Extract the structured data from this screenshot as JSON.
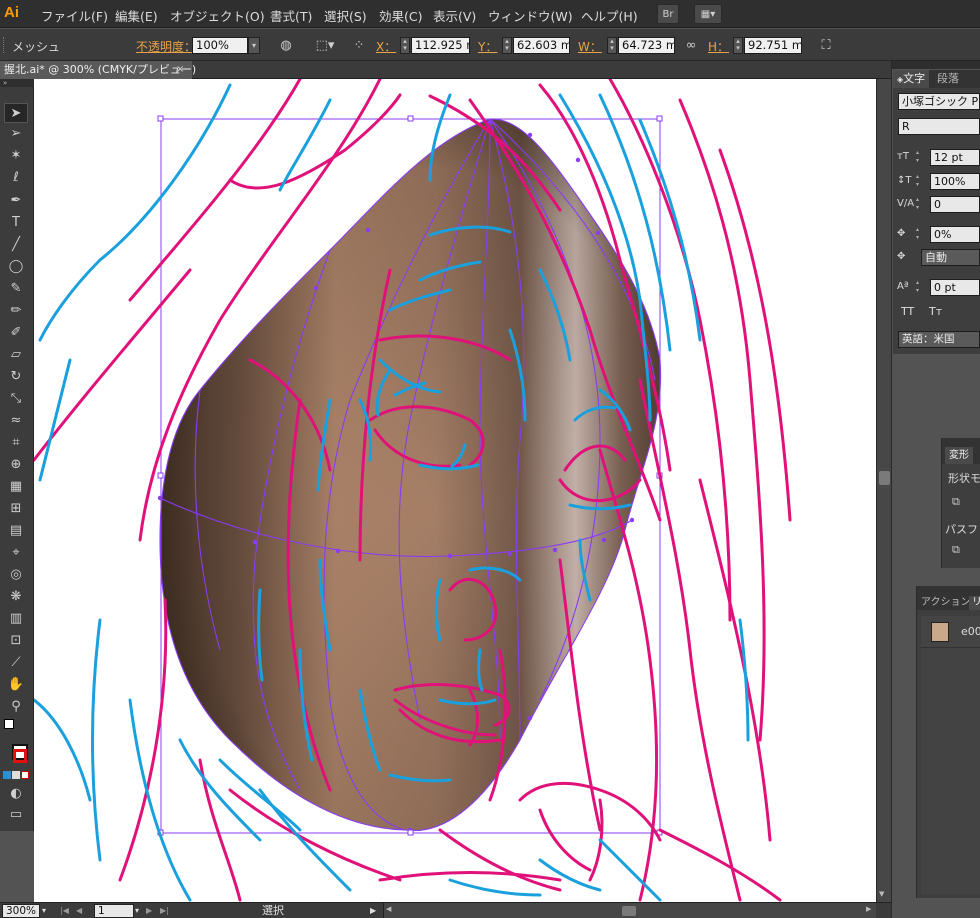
{
  "app": {
    "logo": "Ai"
  },
  "menu": {
    "items": [
      "ファイル(F)",
      "編集(E)",
      "オブジェクト(O)",
      "書式(T)",
      "選択(S)",
      "効果(C)",
      "表示(V)",
      "ウィンドウ(W)",
      "ヘルプ(H)"
    ],
    "bridge_button": "Br",
    "arrange_button_icon": "arrange-documents-icon"
  },
  "control_bar": {
    "selection_type": "メッシュ",
    "opacity_label": "不透明度：",
    "opacity_value": "100%",
    "x_label": "X：",
    "x_value": "112.925 n",
    "y_label": "Y：",
    "y_value": "62.603 mi",
    "w_label": "W：",
    "w_value": "64.723 mi",
    "h_label": "H：",
    "h_value": "92.751 mi"
  },
  "document": {
    "tab_title": "握北.ai* @ 300% (CMYK/プレビュー)",
    "close_glyph": "×"
  },
  "tools": [
    {
      "name": "selection-tool-icon",
      "glyph": "➤"
    },
    {
      "name": "direct-selection-tool-icon",
      "glyph": "➢"
    },
    {
      "name": "magic-wand-tool-icon",
      "glyph": "✶"
    },
    {
      "name": "lasso-tool-icon",
      "glyph": "ℓ"
    },
    {
      "name": "pen-tool-icon",
      "glyph": "✒"
    },
    {
      "name": "type-tool-icon",
      "glyph": "T"
    },
    {
      "name": "line-tool-icon",
      "glyph": "╱"
    },
    {
      "name": "ellipse-tool-icon",
      "glyph": "◯"
    },
    {
      "name": "paintbrush-tool-icon",
      "glyph": "✎"
    },
    {
      "name": "pencil-tool-icon",
      "glyph": "✏"
    },
    {
      "name": "blob-brush-tool-icon",
      "glyph": "✐"
    },
    {
      "name": "eraser-tool-icon",
      "glyph": "▱"
    },
    {
      "name": "rotate-tool-icon",
      "glyph": "↻"
    },
    {
      "name": "scale-tool-icon",
      "glyph": "⤡"
    },
    {
      "name": "warp-tool-icon",
      "glyph": "≈"
    },
    {
      "name": "free-transform-tool-icon",
      "glyph": "⌗"
    },
    {
      "name": "shape-builder-tool-icon",
      "glyph": "⊕"
    },
    {
      "name": "perspective-grid-tool-icon",
      "glyph": "▦"
    },
    {
      "name": "mesh-tool-icon",
      "glyph": "⊞"
    },
    {
      "name": "gradient-tool-icon",
      "glyph": "▤"
    },
    {
      "name": "eyedropper-tool-icon",
      "glyph": "⌖"
    },
    {
      "name": "blend-tool-icon",
      "glyph": "◎"
    },
    {
      "name": "symbol-sprayer-tool-icon",
      "glyph": "❋"
    },
    {
      "name": "column-graph-tool-icon",
      "glyph": "▥"
    },
    {
      "name": "artboard-tool-icon",
      "glyph": "⊡"
    },
    {
      "name": "slice-tool-icon",
      "glyph": "⟋"
    },
    {
      "name": "hand-tool-icon",
      "glyph": "✋"
    },
    {
      "name": "zoom-tool-icon",
      "glyph": "⚲"
    }
  ],
  "status": {
    "zoom": "300%",
    "artboard": "1",
    "tool_name": "選択"
  },
  "character_panel": {
    "tab_character": "文字",
    "tab_paragraph": "段落",
    "font_family": "小塚ゴシック P",
    "font_style": "R",
    "font_size": "12 pt",
    "vertical_scale": "100%",
    "kerning": "0",
    "tsume": "0%",
    "aki": "自動",
    "baseline_shift": "0 pt",
    "caps_glyph": "TT",
    "smallcaps_glyph": "Tт",
    "language": "英語：米国"
  },
  "transform_panel": {
    "title": "変形",
    "shape_mode_label": "形状モ",
    "pathfinder_label": "パスフ"
  },
  "actions_panel": {
    "tab_actions": "アクション",
    "tab_links": "リ",
    "link_item": "e00"
  },
  "colors": {
    "accent_magenta": "#e0127a",
    "accent_cyan": "#1aa0dc",
    "mesh_purple": "#8a3cf0",
    "brown_dark": "#55402f",
    "skin_mid": "#b58a6f"
  }
}
